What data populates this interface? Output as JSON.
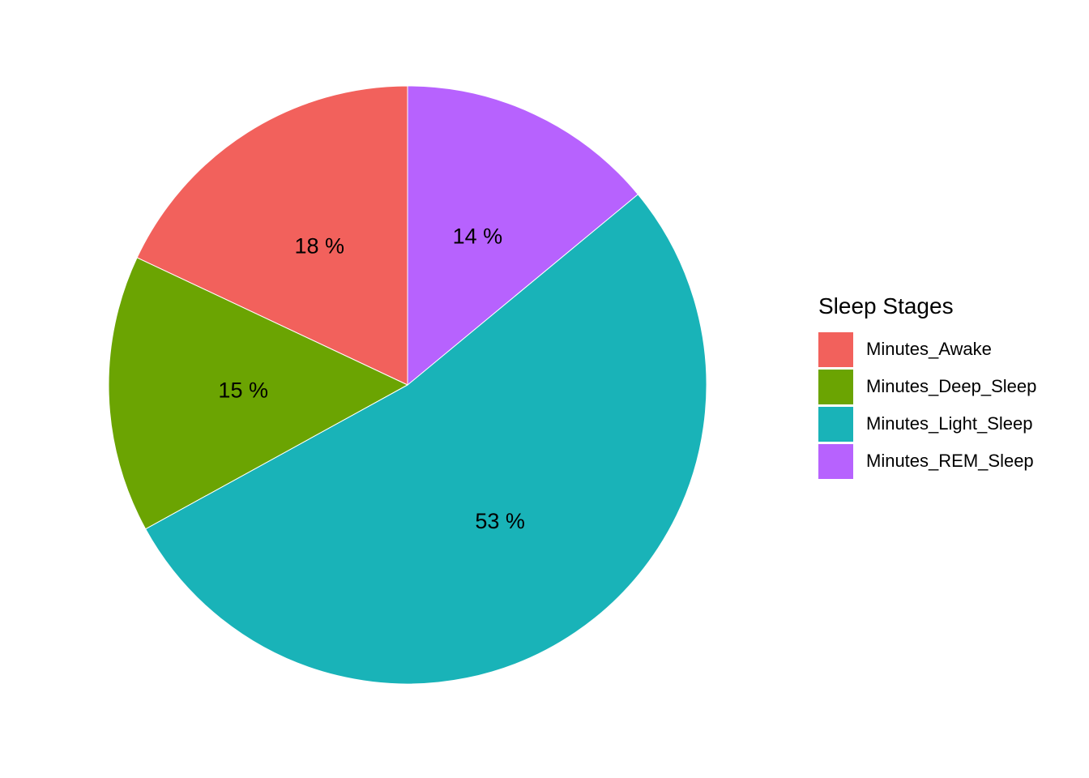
{
  "chart_data": {
    "type": "pie",
    "legend_title": "Sleep Stages",
    "legend_position": "right",
    "slices": [
      {
        "name": "Minutes_Awake",
        "value": 18,
        "label": "18 %",
        "color": "#F2615C"
      },
      {
        "name": "Minutes_Deep_Sleep",
        "value": 15,
        "label": "15 %",
        "color": "#6BA402"
      },
      {
        "name": "Minutes_Light_Sleep",
        "value": 53,
        "label": "53 %",
        "color": "#19B3B8"
      },
      {
        "name": "Minutes_REM_Sleep",
        "value": 14,
        "label": "14 %",
        "color": "#B762FE"
      }
    ],
    "direction": "counterclockwise",
    "start_angle": "12 o'clock"
  }
}
